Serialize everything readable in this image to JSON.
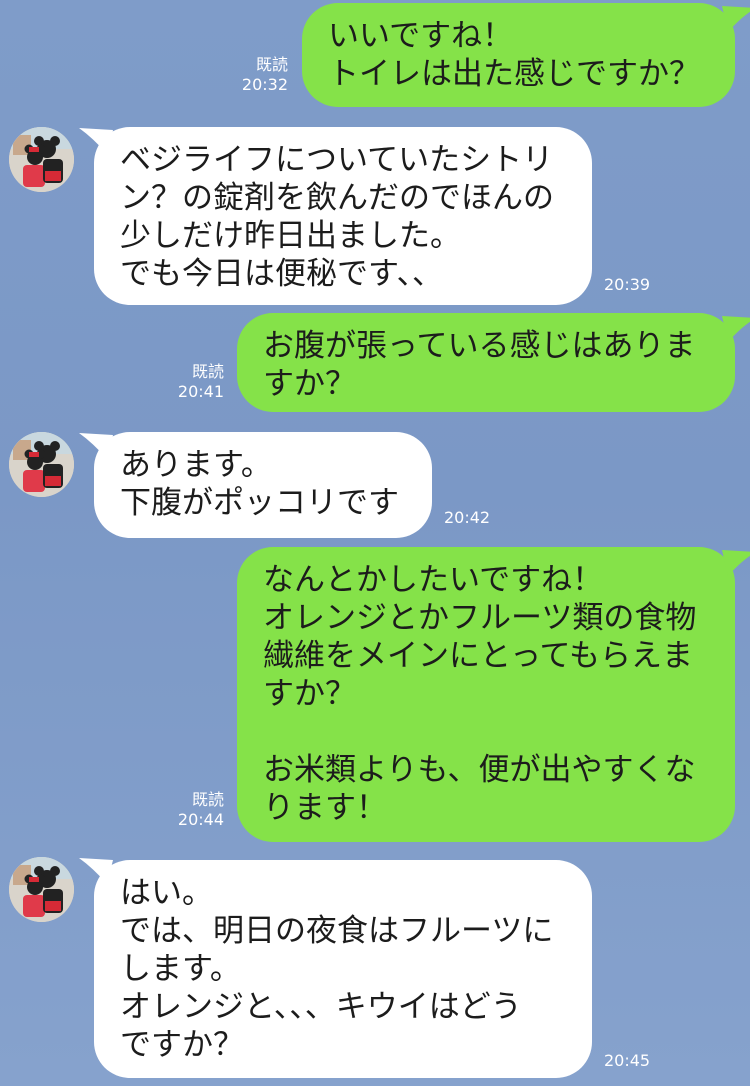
{
  "theme": {
    "chat_bg": "#7f9cc9",
    "outgoing_bubble": "#85e249",
    "incoming_bubble": "#ffffff"
  },
  "messages": [
    {
      "dir": "out",
      "text": "いいですね！\nトイレは出た感じですか？",
      "read": "既読",
      "time": "20:32"
    },
    {
      "dir": "in",
      "text": "ベジライフについていたシトリ\nン？の錠剤を飲んだのでほんの\n少しだけ昨日出ました。\nでも今日は便秘です、、",
      "time": "20:39",
      "avatar": "minnie-mickey-avatar"
    },
    {
      "dir": "out",
      "text": "お腹が張っている感じはありま\nすか？",
      "read": "既読",
      "time": "20:41"
    },
    {
      "dir": "in",
      "text": "あります。\n下腹がポッコリです",
      "time": "20:42",
      "avatar": "minnie-mickey-avatar"
    },
    {
      "dir": "out",
      "text": "なんとかしたいですね！\nオレンジとかフルーツ類の食物\n繊維をメインにとってもらえま\nすか？\n\nお米類よりも、便が出やすくな\nります！",
      "read": "既読",
      "time": "20:44"
    },
    {
      "dir": "in",
      "text": "はい。\nでは、明日の夜食はフルーツに\nします。\nオレンジと、、、キウイはどう\nですか？",
      "time": "20:45",
      "avatar": "minnie-mickey-avatar"
    }
  ]
}
